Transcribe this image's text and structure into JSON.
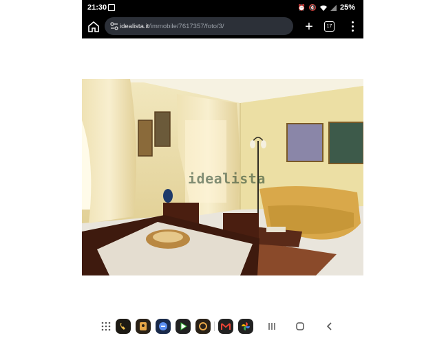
{
  "status_bar": {
    "time": "21:30",
    "battery": "25%",
    "icons": [
      "gallery-icon",
      "alarm-icon",
      "mute-icon",
      "wifi-icon",
      "signal-icon"
    ]
  },
  "browser": {
    "url_host": "idealista.it",
    "url_path": "/immobile/7617357/foto/3/",
    "tab_count": "17"
  },
  "photo": {
    "watermark": "idealista"
  },
  "nav_bar": {
    "apps": [
      "phone-app-icon",
      "contacts-app-icon",
      "messages-app-icon",
      "play-store-app-icon",
      "camera-app-icon",
      "gmail-app-icon",
      "photos-app-icon"
    ],
    "buttons": [
      "recents-button",
      "home-button",
      "back-button"
    ]
  },
  "colors": {
    "accent_url_bg": "#2c3038",
    "wall": "#e8d9a0",
    "curtain": "#efe3b8",
    "sofa": "#d9a84a"
  }
}
